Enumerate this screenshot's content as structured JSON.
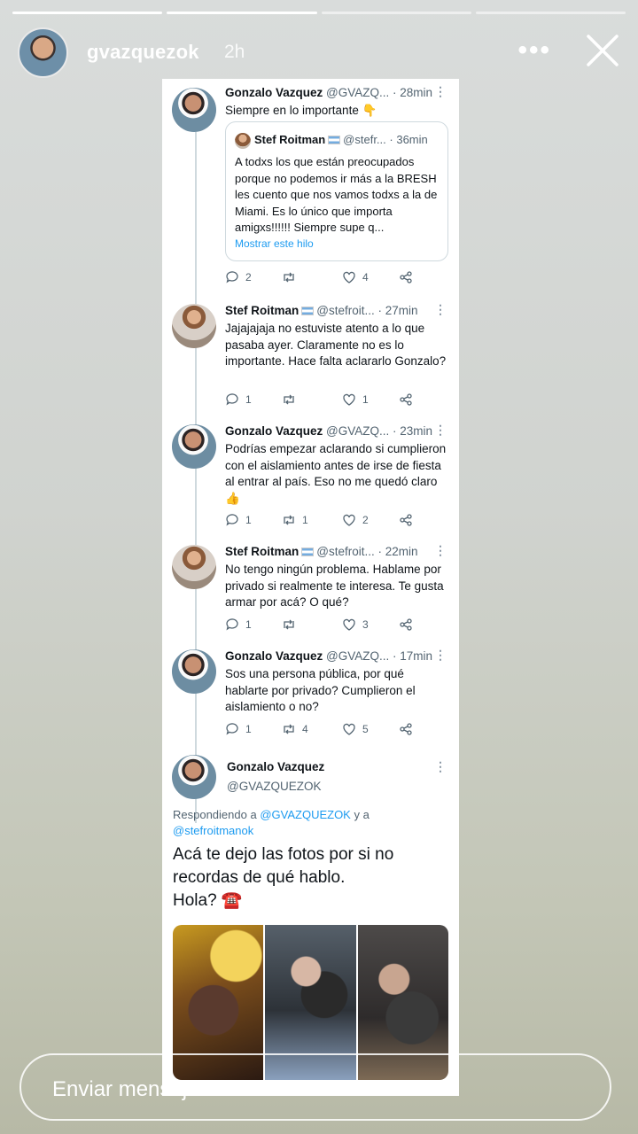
{
  "story": {
    "username": "gvazquezok",
    "time_ago": "2h",
    "progress_total": 4,
    "progress_current": 2
  },
  "tweets": [
    {
      "name": "Gonzalo Vazquez",
      "handle": "@GVAZQ...",
      "time": "28min",
      "text": "Siempre en lo importante 👇",
      "quote": {
        "name": "Stef Roitman",
        "handle": "@stefr...",
        "time": "36min",
        "text": "A todxs los que están preocupados porque no podemos ir más a la BRESH les cuento que nos vamos todxs a la de Miami. Es lo único que importa amigxs!!!!!! Siempre supe q...",
        "link": "Mostrar este hilo"
      },
      "replies": "2",
      "retweets": "",
      "likes": "4"
    },
    {
      "name": "Stef Roitman",
      "handle": "@stefroit...",
      "time": "27min",
      "text": "Jajajajaja no estuviste atento a lo que pasaba ayer. Claramente no es lo importante. Hace falta aclararlo Gonzalo?",
      "replies": "1",
      "retweets": "",
      "likes": "1"
    },
    {
      "name": "Gonzalo Vazquez",
      "handle": "@GVAZQ...",
      "time": "23min",
      "text": "Podrías empezar aclarando si cumplieron con el aislamiento antes de irse de fiesta al entrar al país. Eso no me quedó claro 👍",
      "replies": "1",
      "retweets": "1",
      "likes": "2"
    },
    {
      "name": "Stef Roitman",
      "handle": "@stefroit...",
      "time": "22min",
      "text": "No tengo ningún problema. Hablame por privado si realmente te interesa. Te gusta armar por acá? O qué?",
      "replies": "1",
      "retweets": "",
      "likes": "3"
    },
    {
      "name": "Gonzalo Vazquez",
      "handle": "@GVAZQ...",
      "time": "17min",
      "text": "Sos una persona pública, por qué hablarte por privado? Cumplieron el aislamiento o no?",
      "replies": "1",
      "retweets": "4",
      "likes": "5"
    }
  ],
  "last_tweet": {
    "name": "Gonzalo Vazquez",
    "handle": "@GVAZQUEZOK",
    "replying_prefix": "Respondiendo a",
    "replying_user1": "@GVAZQUEZOK",
    "replying_and": "y a",
    "replying_user2": "@stefroitmanok",
    "text_line1": "Acá te dejo las fotos por si no",
    "text_line2": "recordas de qué hablo.",
    "text_line3": "Hola? ☎️"
  },
  "message_bar": {
    "placeholder": "Enviar mensaje"
  },
  "colors": {
    "link": "#1d9bf0",
    "muted": "#536471",
    "thread_line": "#cfd9de"
  }
}
